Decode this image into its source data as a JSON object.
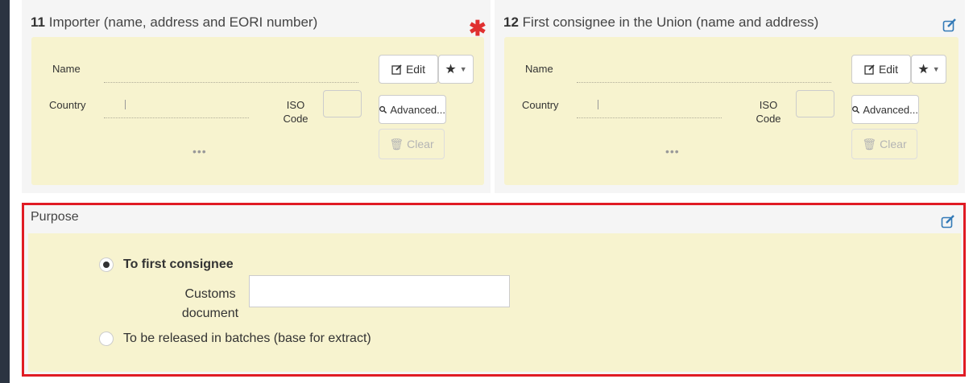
{
  "importer": {
    "number": "11",
    "title": "Importer (name, address and EORI number)",
    "required_mark": "✱",
    "name_label": "Name",
    "country_label": "Country",
    "iso_label": "ISO\nCode",
    "ellipsis": "•••",
    "edit_label": "Edit",
    "advanced_label": "Advanced...",
    "clear_label": "Clear"
  },
  "consignee": {
    "number": "12",
    "title": "First consignee in the Union (name and address)",
    "name_label": "Name",
    "country_label": "Country",
    "iso_label": "ISO\nCode",
    "ellipsis": "•••",
    "edit_label": "Edit",
    "advanced_label": "Advanced...",
    "clear_label": "Clear"
  },
  "purpose": {
    "title": "Purpose",
    "option_first": "To first consignee",
    "customs_label": "Customs\ndocument",
    "customs_value": "",
    "option_batches": "To be released in batches (base for extract)",
    "selected": "To first consignee"
  },
  "colors": {
    "panel_bg": "#f5f5f5",
    "box_bg": "#f7f3cf",
    "accent": "#337ab7",
    "highlight": "#e01b24",
    "required": "#e03030"
  }
}
